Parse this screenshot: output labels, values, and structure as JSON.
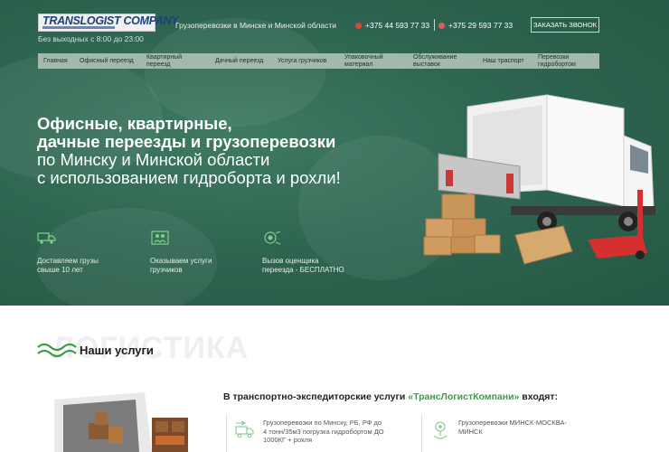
{
  "header": {
    "logo_text": "TRANSLOGIST COMPANY",
    "hours": "Без выходных с 8:00 до 23:00",
    "tagline": "Грузоперевозки в Минске и Минской области",
    "phone1": "+375 44 593 77 33",
    "phone2": "+375 29 593 77 33",
    "call_button": "ЗАКАЗАТЬ ЗВОНОК"
  },
  "nav": {
    "items": [
      {
        "label": "Главная"
      },
      {
        "label": "Офисный переезд"
      },
      {
        "label": "Квартирный\nпереезд"
      },
      {
        "label": "Дачный переезд"
      },
      {
        "label": "Услуга грузчиков"
      },
      {
        "label": "Упаковочный\nматериал"
      },
      {
        "label": "Обслуживание\nвыставок"
      },
      {
        "label": "Наш траспорт"
      },
      {
        "label": "Перевозки\nгидробортом"
      }
    ]
  },
  "hero": {
    "line1": "Офисные, квартирные,",
    "line2": "дачные переезды и грузоперевозки",
    "line3": "по Минску и Минской области",
    "line4": "с использованием гидроборта и рохли!",
    "features": [
      {
        "text": "Доставляем грузы\nсвыше 10 лет",
        "icon": "truck-icon"
      },
      {
        "text": "Оказываем услуги\nгрузчиков",
        "icon": "loaders-icon"
      },
      {
        "text": "Вызов оценщика\nпереезда - БЕСПЛАТНО",
        "icon": "appraiser-icon"
      }
    ]
  },
  "services": {
    "background_word": "ЛОГИСТИКА",
    "title": "Наши услуги",
    "intro_prefix": "В транспортно-экспедиторские услуги ",
    "intro_company": "«ТрансЛогистКомпани»",
    "intro_suffix": " входят:",
    "cards": [
      {
        "text": "Грузоперевозки по Минску, РБ, РФ до\n4 тонн/35м3 погрузка гидробортом ДО\n1000КГ + рохля",
        "icon": "truck-outline-icon"
      },
      {
        "text": "Грузоперевозки МИНСК-МОСКВА-\nМИНСК",
        "icon": "map-pin-icon"
      }
    ]
  },
  "colors": {
    "hero_green": "#2f6651",
    "accent_green": "#3f9a4a",
    "nav_bg": "#a5b8ae"
  }
}
